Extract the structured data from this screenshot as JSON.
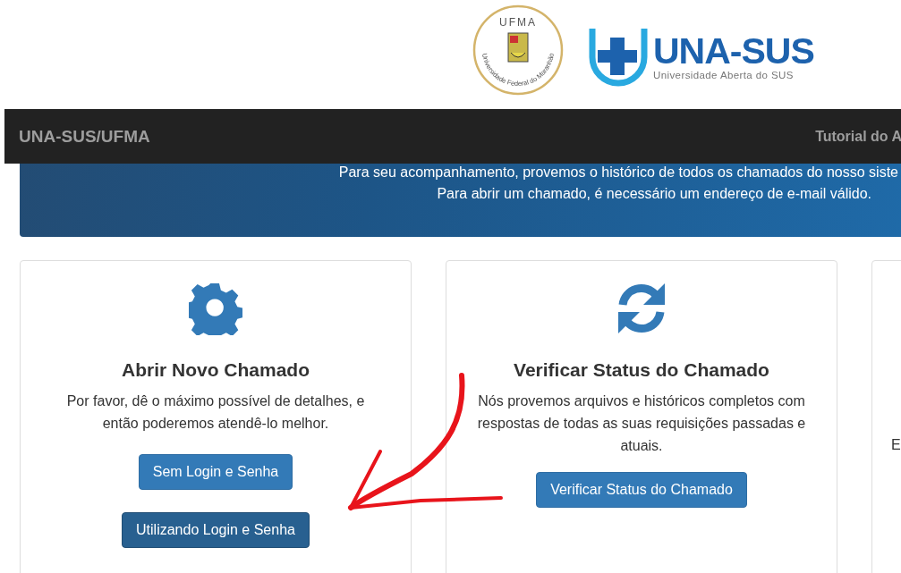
{
  "header": {
    "seal": {
      "title": "UFMA",
      "ring": "Universidade Federal do Maranhão"
    },
    "brand": {
      "name": "UNA-SUS",
      "tagline": "Universidade Aberta do SUS"
    }
  },
  "navbar": {
    "brand": "UNA-SUS/UFMA",
    "links": [
      "Tutorial do A"
    ]
  },
  "banner": {
    "lines": [
      "Para seu acompanhamento, provemos o histórico de todos os chamados do nosso siste",
      "Para abrir um chamado, é necessário um endereço de e-mail válido."
    ]
  },
  "cards": [
    {
      "kind": "gear",
      "title": "Abrir Novo Chamado",
      "text": "Por favor, dê o máximo possível de detalhes, e então poderemos atendê-lo melhor.",
      "buttons": [
        {
          "label": "Sem Login e Senha",
          "active": false
        },
        {
          "label": "Utilizando Login e Senha",
          "active": true
        }
      ]
    },
    {
      "kind": "refresh",
      "title": "Verificar Status do Chamado",
      "text": "Nós provemos arquivos e históricos completos com respostas de todas as suas requisições passadas e atuais.",
      "buttons": [
        {
          "label": "Verificar Status do Chamado",
          "active": false
        }
      ]
    },
    {
      "kind": "partial",
      "text": "E"
    }
  ]
}
